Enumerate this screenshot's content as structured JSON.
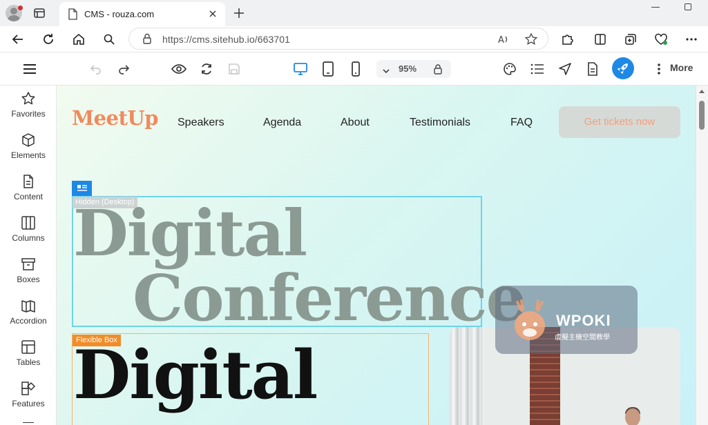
{
  "browser": {
    "tab_title": "CMS - rouza.com",
    "url": "https://cms.sitehub.io/663701"
  },
  "editor_toolbar": {
    "zoom": "95%",
    "more_label": "More",
    "accent_color": "#1e88e5"
  },
  "sidebar": {
    "items": [
      {
        "label": "Favorites",
        "icon": "star-icon"
      },
      {
        "label": "Elements",
        "icon": "cube-icon"
      },
      {
        "label": "Content",
        "icon": "document-icon"
      },
      {
        "label": "Columns",
        "icon": "columns-icon"
      },
      {
        "label": "Boxes",
        "icon": "box-icon"
      },
      {
        "label": "Accordion",
        "icon": "accordion-icon"
      },
      {
        "label": "Tables",
        "icon": "table-icon"
      },
      {
        "label": "Features",
        "icon": "features-icon"
      }
    ]
  },
  "site": {
    "logo": "MeetUp",
    "logo_color": "#f08a5d",
    "nav": [
      "Speakers",
      "Agenda",
      "About",
      "Testimonials",
      "FAQ"
    ],
    "cta": "Get tickets now",
    "hidden_tag": "Hidden (Desktop)",
    "hero_line1": "Digital",
    "hero_line2": "Conference",
    "flex_tag": "Flexible Box",
    "hero_black": "Digital"
  },
  "watermark": {
    "brand": "WPOKI",
    "subtitle": "虛擬主機空間教學"
  }
}
